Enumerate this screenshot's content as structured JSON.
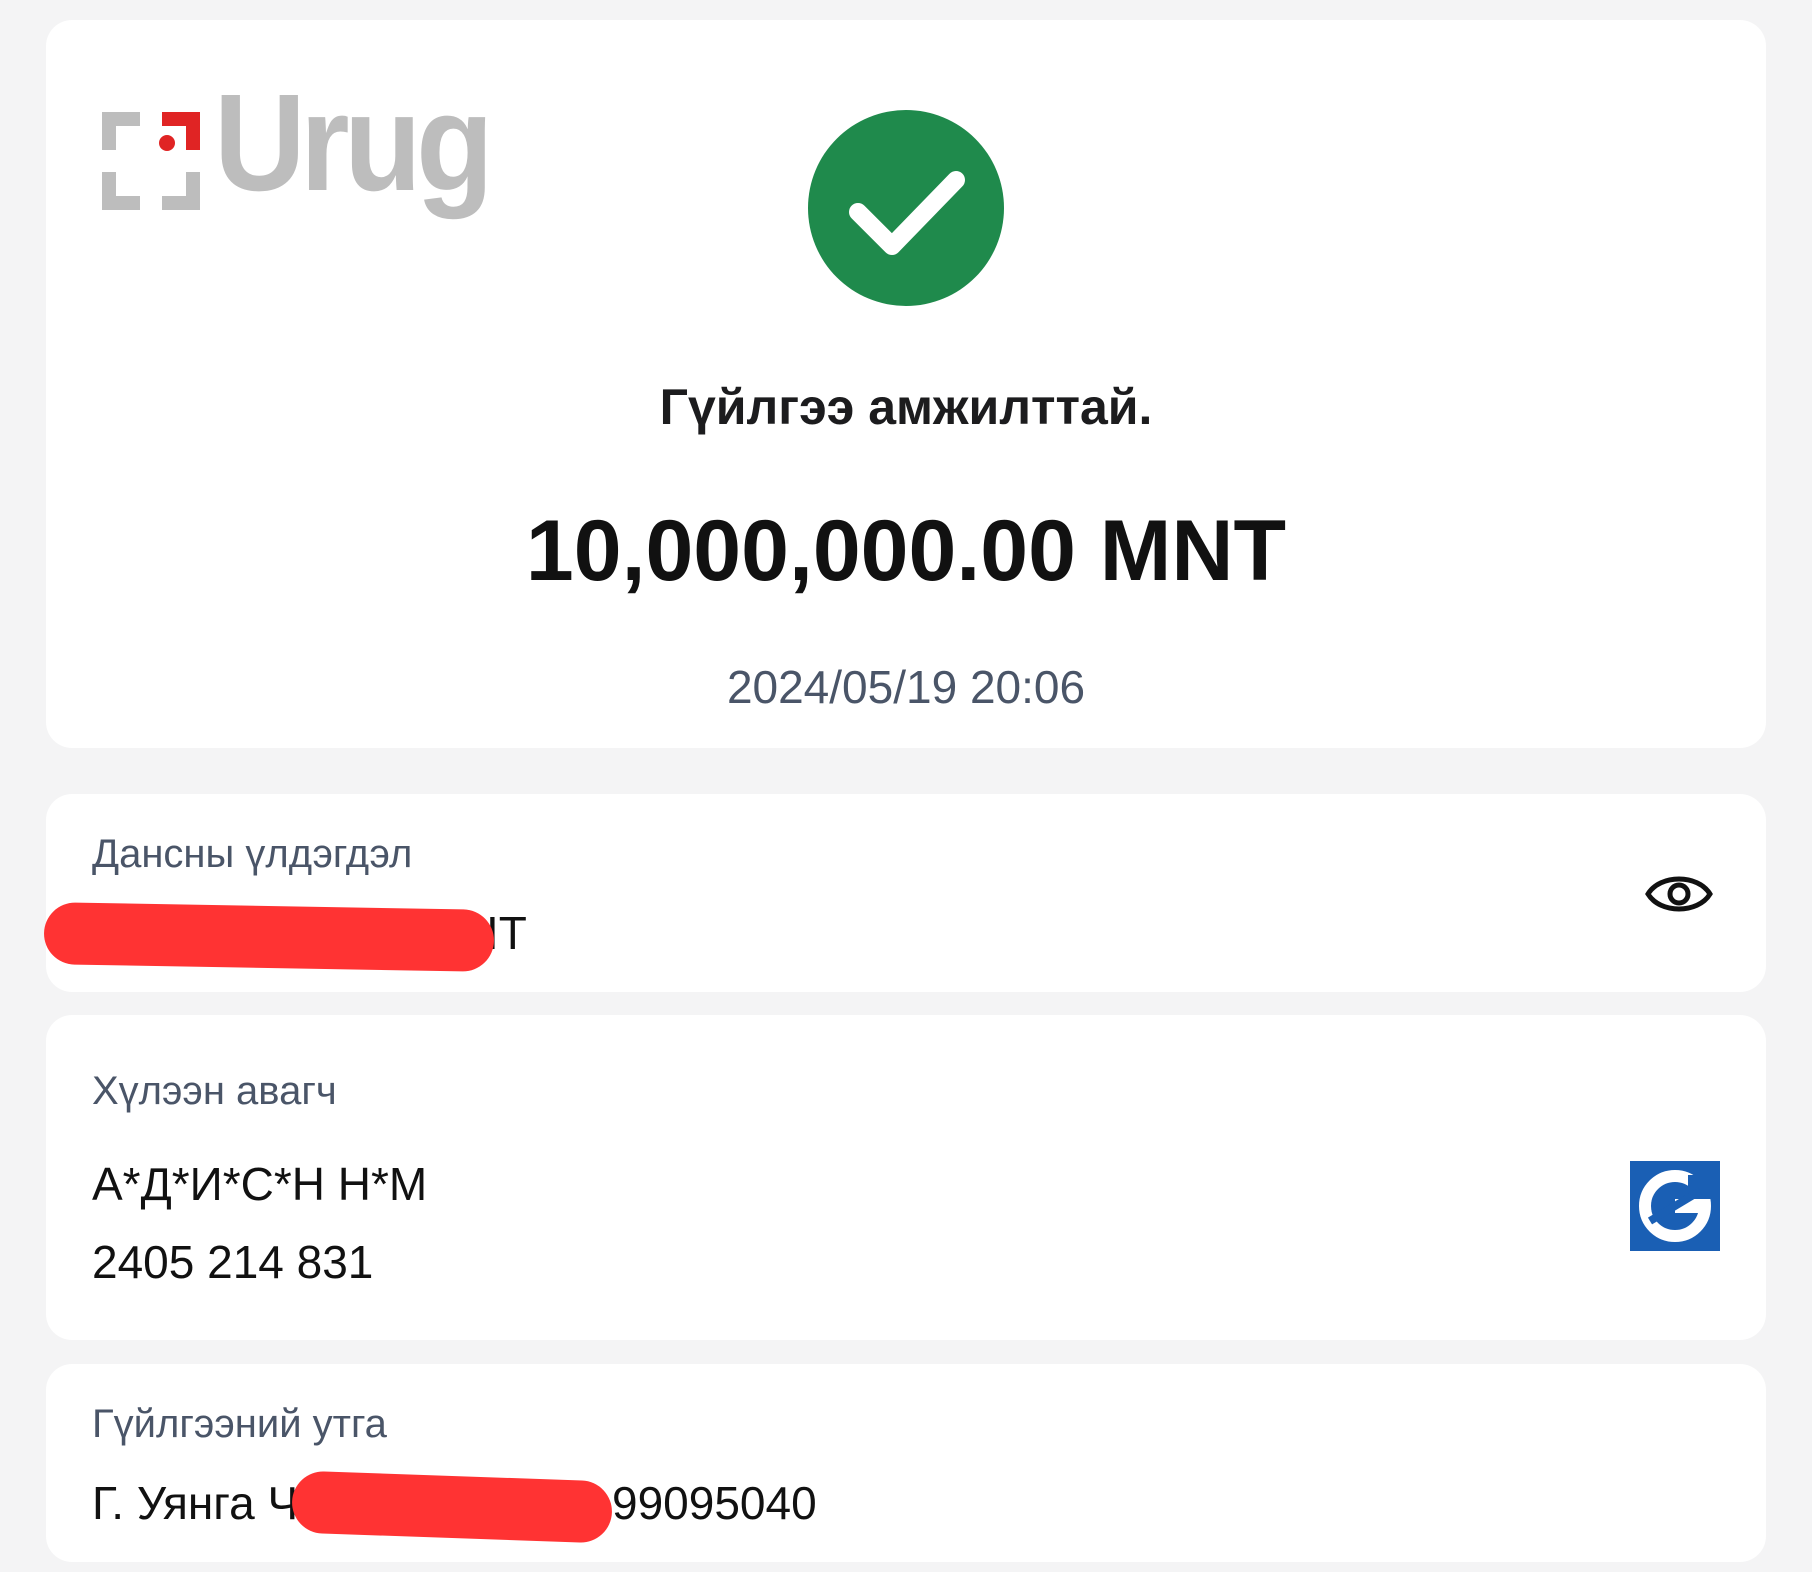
{
  "brand": {
    "logo_text": "Urug"
  },
  "status": {
    "icon": "check-icon",
    "title": "Гүйлгээ амжилттай.",
    "amount": "10,000,000.00 MNT",
    "datetime": "2024/05/19 20:06",
    "color": "#1f8a4c"
  },
  "balance": {
    "label": "Дансны үлдэгдэл",
    "value_visible_suffix": "IT",
    "redacted": true,
    "toggle_icon": "eye-icon"
  },
  "recipient": {
    "label": "Хүлээн авагч",
    "name": "А*Д*И*С*Н Н*М",
    "account_number": "2405 214 831",
    "bank_icon": "bank-logo-icon"
  },
  "description": {
    "label": "Гүйлгээний утга",
    "value_prefix": "Г. Уянга Ч",
    "value_suffix": "99095040",
    "redacted": true
  }
}
